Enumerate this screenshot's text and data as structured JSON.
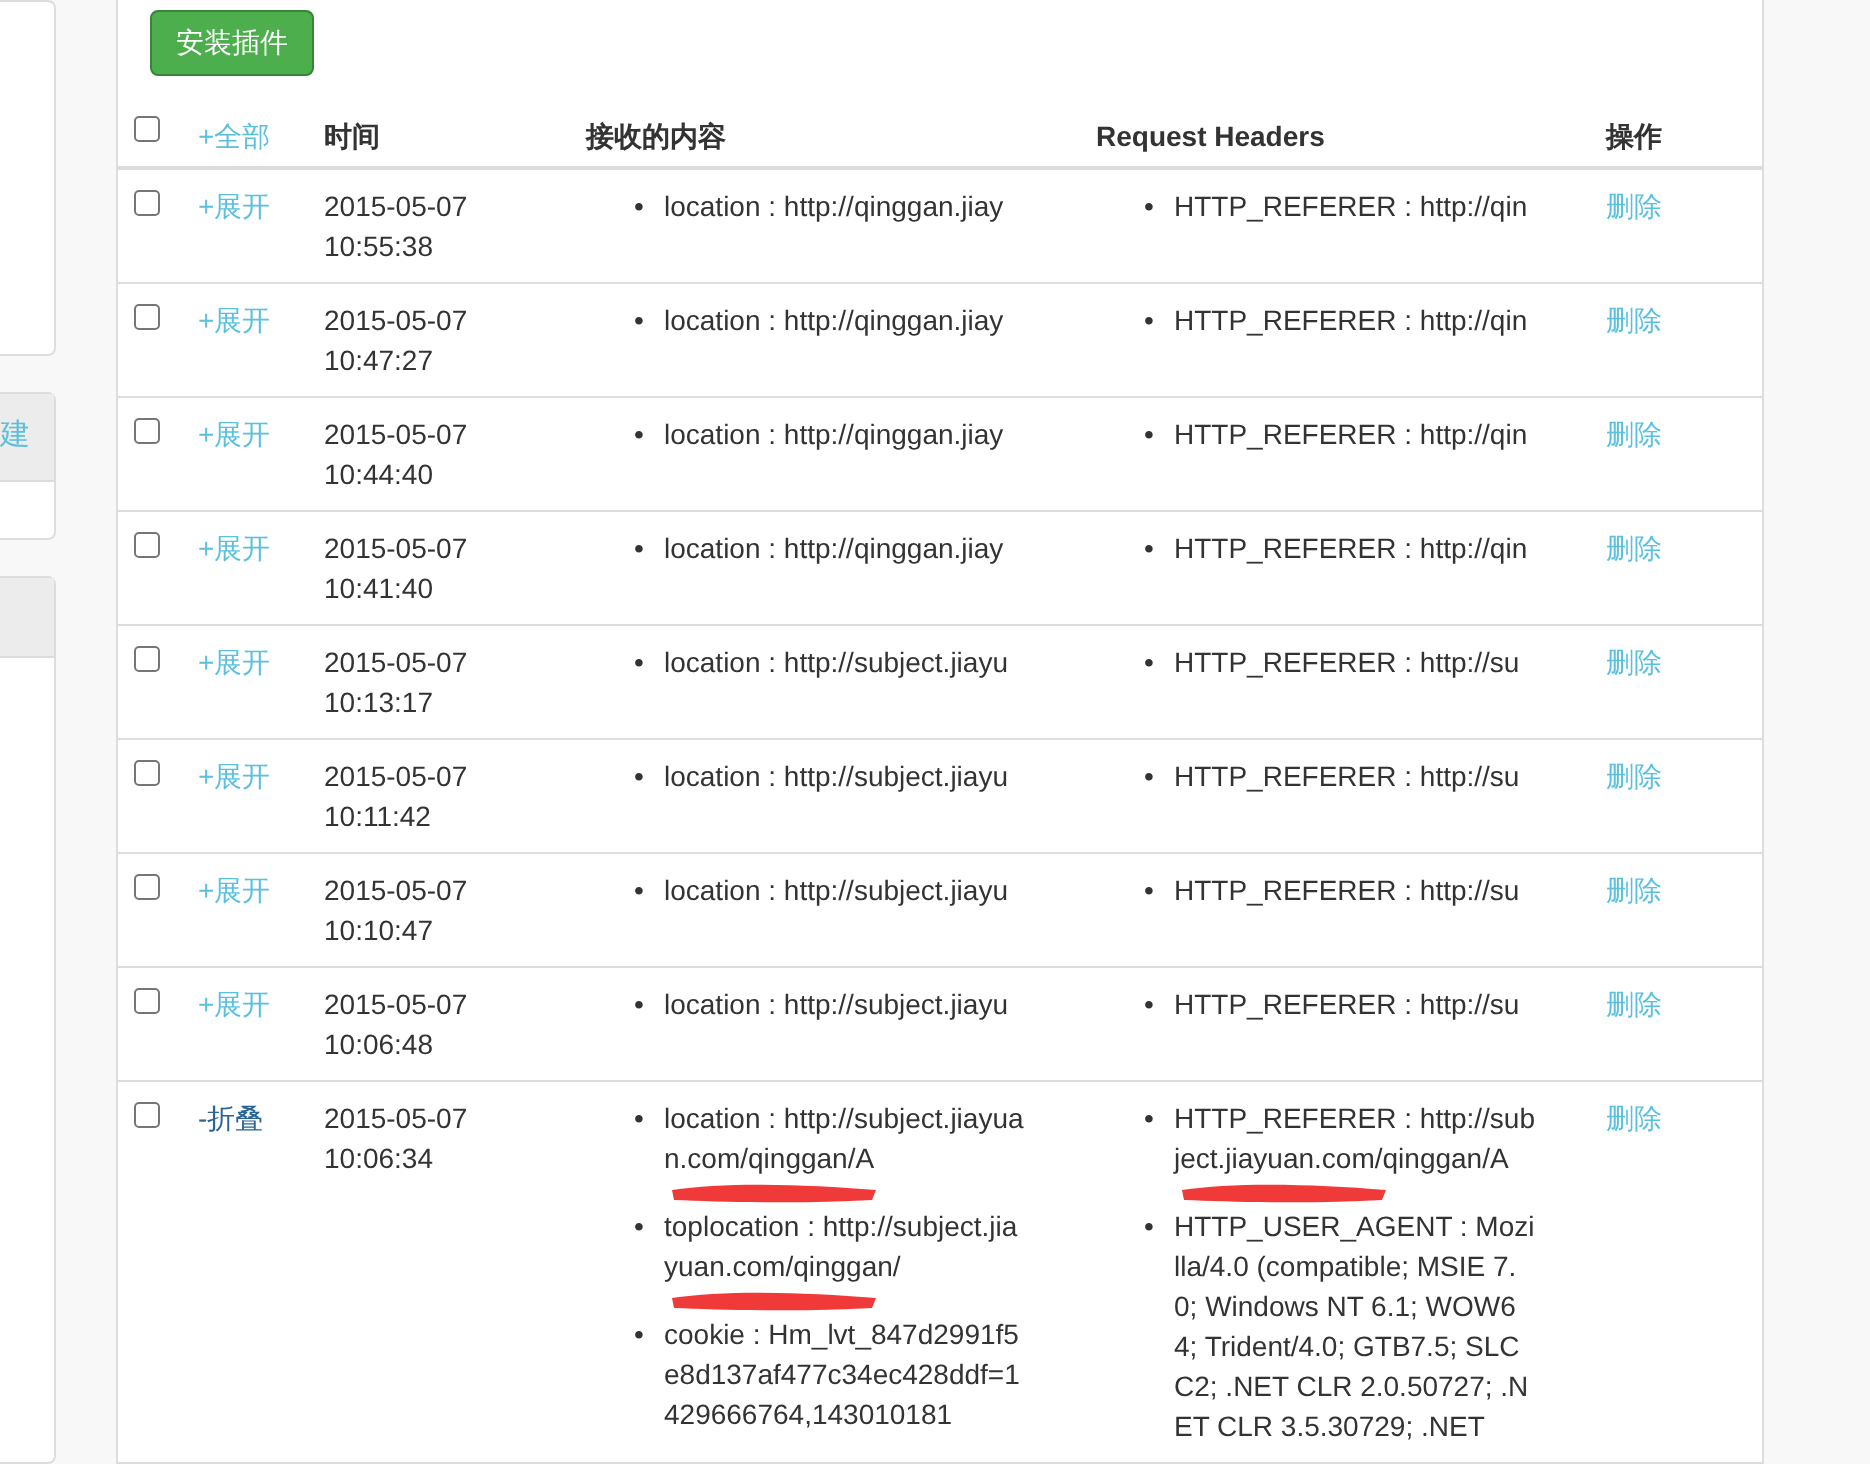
{
  "sidebar": {
    "button_label": "建"
  },
  "install_button": "安装插件",
  "bullet": "•",
  "select_all_checked": false,
  "table": {
    "columns": {
      "toggle_all": "+全部",
      "time": "时间",
      "content": "接收的内容",
      "headers": "Request Headers",
      "actions": "操作"
    },
    "rows": [
      {
        "checked": false,
        "expanded": false,
        "toggle": "+展开",
        "date": "2015-05-07",
        "time": "10:55:38",
        "content": [
          {
            "text": "location : http://qinggan.jiay",
            "redacted": false
          }
        ],
        "headers": [
          {
            "text": "HTTP_REFERER : http://qin",
            "redacted": false
          }
        ],
        "action": "删除"
      },
      {
        "checked": false,
        "expanded": false,
        "toggle": "+展开",
        "date": "2015-05-07",
        "time": "10:47:27",
        "content": [
          {
            "text": "location : http://qinggan.jiay",
            "redacted": false
          }
        ],
        "headers": [
          {
            "text": "HTTP_REFERER : http://qin",
            "redacted": false
          }
        ],
        "action": "删除"
      },
      {
        "checked": false,
        "expanded": false,
        "toggle": "+展开",
        "date": "2015-05-07",
        "time": "10:44:40",
        "content": [
          {
            "text": "location : http://qinggan.jiay",
            "redacted": false
          }
        ],
        "headers": [
          {
            "text": "HTTP_REFERER : http://qin",
            "redacted": false
          }
        ],
        "action": "删除"
      },
      {
        "checked": false,
        "expanded": false,
        "toggle": "+展开",
        "date": "2015-05-07",
        "time": "10:41:40",
        "content": [
          {
            "text": "location : http://qinggan.jiay",
            "redacted": false
          }
        ],
        "headers": [
          {
            "text": "HTTP_REFERER : http://qin",
            "redacted": false
          }
        ],
        "action": "删除"
      },
      {
        "checked": false,
        "expanded": false,
        "toggle": "+展开",
        "date": "2015-05-07",
        "time": "10:13:17",
        "content": [
          {
            "text": "location : http://subject.jiayu",
            "redacted": false
          }
        ],
        "headers": [
          {
            "text": "HTTP_REFERER : http://su",
            "redacted": false
          }
        ],
        "action": "删除"
      },
      {
        "checked": false,
        "expanded": false,
        "toggle": "+展开",
        "date": "2015-05-07",
        "time": "10:11:42",
        "content": [
          {
            "text": "location : http://subject.jiayu",
            "redacted": false
          }
        ],
        "headers": [
          {
            "text": "HTTP_REFERER : http://su",
            "redacted": false
          }
        ],
        "action": "删除"
      },
      {
        "checked": false,
        "expanded": false,
        "toggle": "+展开",
        "date": "2015-05-07",
        "time": "10:10:47",
        "content": [
          {
            "text": "location : http://subject.jiayu",
            "redacted": false
          }
        ],
        "headers": [
          {
            "text": "HTTP_REFERER : http://su",
            "redacted": false
          }
        ],
        "action": "删除"
      },
      {
        "checked": false,
        "expanded": false,
        "toggle": "+展开",
        "date": "2015-05-07",
        "time": "10:06:48",
        "content": [
          {
            "text": "location : http://subject.jiayu",
            "redacted": false
          }
        ],
        "headers": [
          {
            "text": "HTTP_REFERER : http://su",
            "redacted": false
          }
        ],
        "action": "删除"
      },
      {
        "checked": false,
        "expanded": true,
        "toggle": "-折叠",
        "date": "2015-05-07",
        "time": "10:06:34",
        "content": [
          {
            "text": "location : http://subject.jiayuan.com/qinggan/A",
            "redacted": true
          },
          {
            "text": "toplocation : http://subject.jiayuan.com/qinggan/",
            "redacted": true
          },
          {
            "text": "cookie : Hm_lvt_847d2991f5e8d137af477c34ec428ddf=1429666764,143010181",
            "redacted": false
          }
        ],
        "headers": [
          {
            "text": "HTTP_REFERER : http://subject.jiayuan.com/qinggan/A",
            "redacted": true
          },
          {
            "text": "HTTP_USER_AGENT : Mozilla/4.0 (compatible; MSIE 7.0; Windows NT 6.1; WOW64; Trident/4.0; GTB7.5; SLCC2; .NET CLR 2.0.50727; .NET CLR 3.5.30729; .NET",
            "redacted": false
          }
        ],
        "action": "删除"
      }
    ]
  }
}
